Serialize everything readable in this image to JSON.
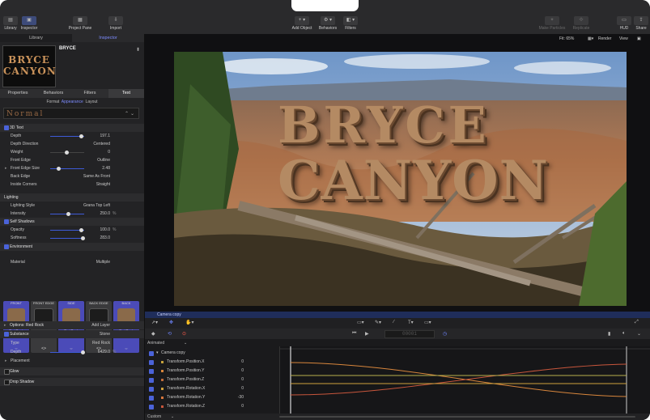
{
  "toolbar": {
    "library": "Library",
    "inspector": "Inspector",
    "project_pane": "Project Pane",
    "import": "Import",
    "add_object": "Add Object",
    "behaviors": "Behaviors",
    "filters": "Filters",
    "make_particles": "Make Particles",
    "replicate": "Replicate",
    "hud": "HUD",
    "share": "Share"
  },
  "left_tabs": {
    "library": "Library",
    "inspector": "Inspector"
  },
  "object": {
    "name": "BRYCE",
    "thumb_line1": "BRYCE",
    "thumb_line2": "CANYON"
  },
  "inspector_tabs": [
    "Properties",
    "Behaviors",
    "Filters",
    "Text"
  ],
  "sub_tabs": {
    "format": "Format",
    "appearance": "Appearance",
    "layout": "Layout"
  },
  "preset": "Normal",
  "rows": {
    "text3d": {
      "label": "3D Text"
    },
    "depth": {
      "label": "Depth",
      "value": "197.1"
    },
    "depth_direction": {
      "label": "Depth Direction",
      "value": "Centered"
    },
    "weight": {
      "label": "Weight",
      "value": "0"
    },
    "front_edge": {
      "label": "Front Edge",
      "value": "Outline"
    },
    "front_edge_size": {
      "label": "Front Edge Size",
      "value": "2.48"
    },
    "back_edge": {
      "label": "Back Edge",
      "value": "Same As Front"
    },
    "inside_corners": {
      "label": "Inside Corners",
      "value": "Straight"
    },
    "lighting": {
      "label": "Lighting"
    },
    "lighting_style": {
      "label": "Lighting Style",
      "value": "Grana Top Left"
    },
    "intensity": {
      "label": "Intensity",
      "value": "250.0",
      "unit": "%"
    },
    "self_shadows": {
      "label": "Self Shadows"
    },
    "opacity": {
      "label": "Opacity",
      "value": "100.0",
      "unit": "%"
    },
    "softness": {
      "label": "Softness",
      "value": "283.0"
    },
    "environment": {
      "label": "Environment"
    },
    "material": {
      "label": "Material",
      "value": "Multiple"
    },
    "options": {
      "label": "Options: Red Rock",
      "value": "Add Layer"
    },
    "substance": {
      "label": "Substance",
      "value": "Stone"
    },
    "type": {
      "label": "Type",
      "value": "Red Rock"
    },
    "depth2": {
      "label": "Depth",
      "value": "6429.0",
      "unit": "%"
    },
    "placement": {
      "label": "Placement"
    },
    "glow": {
      "label": "Glow"
    },
    "drop_shadow": {
      "label": "Drop Shadow"
    }
  },
  "materials": [
    {
      "header": "FRONT",
      "name": "Red Rock",
      "dark": false
    },
    {
      "header": "FRONT EDGE",
      "name": "Basic",
      "dark": true
    },
    {
      "header": "SIDE",
      "name": "Red Rock",
      "dark": false
    },
    {
      "header": "BACK EDGE",
      "name": "Basic",
      "dark": true
    },
    {
      "header": "BACK",
      "name": "Red Rock",
      "dark": false
    }
  ],
  "viewer": {
    "fit": "Fit: 65%",
    "render": "Render",
    "view": "View"
  },
  "canvas_text": {
    "line1": "BRYCE",
    "line2": "CANYON"
  },
  "camera_label": "Camera copy",
  "timeline": {
    "animated": "Animated",
    "group": "Camera copy",
    "timecode": "00001",
    "custom": "Custom",
    "keyframes": [
      {
        "name": "Transform.Position.X",
        "value": "0"
      },
      {
        "name": "Transform.Position.Y",
        "value": "0"
      },
      {
        "name": "Transform.Position.Z",
        "value": "0"
      },
      {
        "name": "Transform.Rotation.X",
        "value": "0"
      },
      {
        "name": "Transform.Rotation.Y",
        "value": "-30"
      },
      {
        "name": "Transform.Rotation.Z",
        "value": "0"
      }
    ],
    "colors": {
      "accent": "#4b63d9",
      "material": "#4b4bb8"
    }
  }
}
